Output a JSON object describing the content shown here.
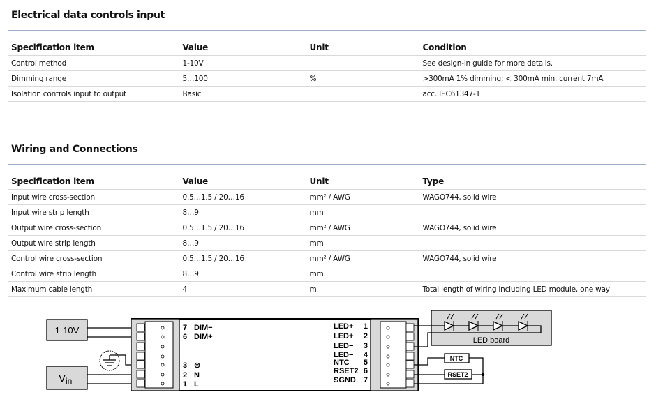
{
  "section1": {
    "title": "Electrical data controls input",
    "headers": [
      "Specification item",
      "Value",
      "Unit",
      "Condition"
    ],
    "rows": [
      [
        "Control method",
        "1-10V",
        "",
        "See design-in guide for more details."
      ],
      [
        "Dimming range",
        "5…100",
        "%",
        ">300mA 1% dimming; < 300mA min. current 7mA"
      ],
      [
        "Isolation controls input to output",
        "Basic",
        "",
        "acc. IEC61347-1"
      ]
    ]
  },
  "section2": {
    "title": "Wiring and Connections",
    "headers": [
      "Specification item",
      "Value",
      "Unit",
      "Type"
    ],
    "rows": [
      [
        "Input wire cross-section",
        "0.5…1.5 / 20…16",
        "mm² / AWG",
        "WAGO744, solid wire"
      ],
      [
        "Input wire strip length",
        "8…9",
        "mm",
        ""
      ],
      [
        "Output wire cross-section",
        "0.5…1.5 / 20…16",
        "mm² / AWG",
        "WAGO744, solid wire"
      ],
      [
        "Output wire strip length",
        "8…9",
        "mm",
        ""
      ],
      [
        "Control wire cross-section",
        "0.5…1.5 / 20…16",
        "mm² / AWG",
        "WAGO744, solid wire"
      ],
      [
        "Control wire strip length",
        "8…9",
        "mm",
        ""
      ],
      [
        "Maximum cable length",
        "4",
        "m",
        "Total length of wiring including LED module, one way"
      ]
    ]
  },
  "diagram": {
    "dim_source": "1-10V",
    "vin": "V",
    "vin_sub": "in",
    "led_board": "LED board",
    "ntc": "NTC",
    "rset2": "RSET2",
    "left_pins": [
      {
        "num": "7",
        "label": "DIM−"
      },
      {
        "num": "6",
        "label": "DIM+"
      },
      {
        "num": "3",
        "label": "⊜"
      },
      {
        "num": "2",
        "label": "N"
      },
      {
        "num": "1",
        "label": "L"
      }
    ],
    "right_pins": [
      {
        "num": "1",
        "label": "LED+"
      },
      {
        "num": "2",
        "label": "LED+"
      },
      {
        "num": "3",
        "label": "LED−"
      },
      {
        "num": "4",
        "label": "LED−"
      },
      {
        "num": "5",
        "label": "NTC"
      },
      {
        "num": "6",
        "label": "RSET2"
      },
      {
        "num": "7",
        "label": "SGND"
      }
    ]
  }
}
